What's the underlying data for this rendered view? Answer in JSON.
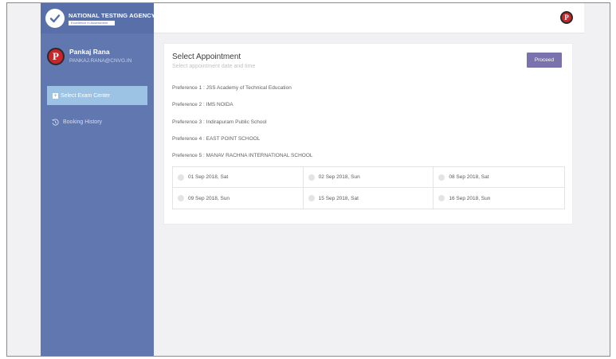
{
  "brand": {
    "title": "NATIONAL TESTING AGENCY",
    "tagline": "Excellence in Assessment"
  },
  "user": {
    "name": "Pankaj Rana",
    "email": "PANKAJ.RANA@CNVG.IN",
    "avatar_letter": "P"
  },
  "sidebar": {
    "items": [
      {
        "label": "Select Exam Center",
        "active": true
      },
      {
        "label": "Booking History",
        "active": false
      }
    ]
  },
  "header": {
    "avatar_letter": "P"
  },
  "card": {
    "title": "Select Appointment",
    "subtitle": "Select appointment date and time",
    "proceed_label": "Proceed",
    "preferences": [
      "Preference 1 : JSS Academy of Technical Education",
      "Preference 2 : IMS NOIDA",
      "Preference 3 : Indirapuram Public School",
      "Preference 4 : EAST POINT SCHOOL",
      "Preference 5 : MANAV RACHNA INTERNATIONAL SCHOOL"
    ],
    "dates": [
      "01 Sep 2018, Sat",
      "02 Sep 2018, Sun",
      "08 Sep 2018, Sat",
      "09 Sep 2018, Sun",
      "15 Sep 2018, Sat",
      "16 Sep 2018, Sun"
    ]
  },
  "colors": {
    "sidebar": "#6077b0",
    "accent": "#7a72ad",
    "active_nav": "#9cc3e4",
    "avatar": "#c8262b"
  }
}
